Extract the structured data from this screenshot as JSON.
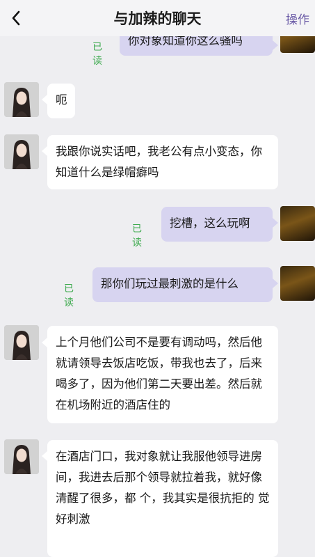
{
  "header": {
    "title": "与加辣的聊天",
    "action": "操作"
  },
  "read_label": "已读",
  "messages": [
    {
      "from": "me",
      "text": "你对象知道你这么骚吗"
    },
    {
      "from": "her",
      "text": "呃"
    },
    {
      "from": "her",
      "text": "我跟你说实话吧，我老公有点小变态，你知道什么是绿帽癖吗"
    },
    {
      "from": "me",
      "text": "挖槽，这么玩啊"
    },
    {
      "from": "me",
      "text": "那你们玩过最刺激的是什么"
    },
    {
      "from": "her",
      "text": "上个月他们公司不是要有调动吗，然后他就请领导去饭店吃饭，带我也去了，后来喝多了，因为他们第二天要出差。然后就在机场附近的酒店住的"
    },
    {
      "from": "her",
      "text": "在酒店门口，我对象就让我服他领导进房间，我进去后那个领导就拉着我，就好像清醒了很多，都 个，我其实是很抗拒的 觉好刺激"
    }
  ],
  "colors": {
    "accent": "#6a5aa6",
    "read": "#3eaa4f",
    "my_bubble": "#d7d4f0"
  }
}
